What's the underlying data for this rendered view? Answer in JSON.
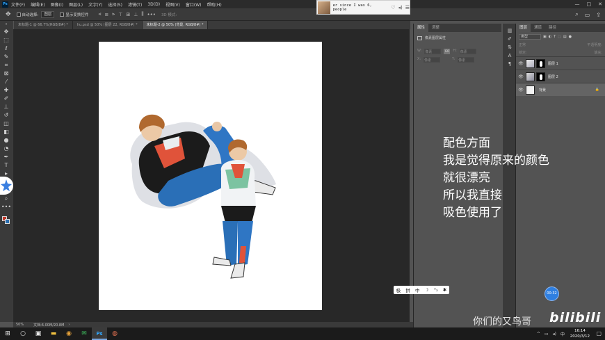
{
  "menubar": {
    "logo": "Ps",
    "items": [
      "文件(F)",
      "编辑(E)",
      "图像(I)",
      "图层(L)",
      "文字(Y)",
      "选择(S)",
      "滤镜(T)",
      "3D(D)",
      "视图(V)",
      "窗口(W)",
      "帮助(H)"
    ],
    "window_controls": [
      "—",
      "□",
      "✕"
    ]
  },
  "options": {
    "auto_select_label": "自动选择:",
    "auto_select_value": "图层",
    "show_transform_label": "显示变换控件",
    "mode_3d_label": "3D 模式:"
  },
  "music": {
    "lyric": "er since I was 6, people",
    "icons": [
      "heart-icon",
      "volume-icon",
      "menu-icon"
    ]
  },
  "tabs": [
    {
      "label": "未标题-1 @ 66.7%(RGB/8#) *",
      "active": false
    },
    {
      "label": "hu.psd @ 50% (图层 22, RGB/8#) *",
      "active": false
    },
    {
      "label": "未标题-2 @ 50% (背景, RGB/8#) *",
      "active": true
    }
  ],
  "status": {
    "zoom": "50%",
    "doc_size": "文档:6.00M/20.8M"
  },
  "properties": {
    "tabs": [
      {
        "label": "属性",
        "active": true
      },
      {
        "label": "调整",
        "active": false
      }
    ],
    "section": "像素图层属性",
    "w_label": "W:",
    "h_label": "H:",
    "x_label": "X:",
    "y_label": "Y:",
    "w_value": "像素",
    "h_value": "像素",
    "x_value": "像素",
    "y_value": "像素",
    "link_label": "GO"
  },
  "layers": {
    "tabs": [
      {
        "label": "图层",
        "active": true
      },
      {
        "label": "通道",
        "active": false
      },
      {
        "label": "路径",
        "active": false
      }
    ],
    "filter_label": "类型",
    "blend_mode": "正常",
    "opacity_label": "不透明度:",
    "lock_label": "锁定:",
    "fill_label": "填充:",
    "items": [
      {
        "name": "图层 1",
        "has_mask": true,
        "locked": false
      },
      {
        "name": "图层 2",
        "has_mask": true,
        "locked": false
      },
      {
        "name": "背景",
        "has_mask": false,
        "locked": true
      }
    ]
  },
  "subtitle": {
    "lines": [
      "配色方面",
      "我是觉得原来的颜色",
      "就很漂亮",
      "所以我直接",
      "吸色使用了"
    ]
  },
  "watermark": {
    "text": "你们的又鸟哥",
    "logo": "bilibili"
  },
  "ime": {
    "items": [
      "极",
      "拼",
      "中",
      "☽",
      "°₂",
      "✱"
    ]
  },
  "timer": {
    "label": "00:32"
  },
  "taskbar": {
    "time": "16:14",
    "date": "2020/3/12"
  },
  "colors": {
    "foreground": "#c0392b",
    "background": "#2b6fb0",
    "canvas": "#ffffff"
  }
}
